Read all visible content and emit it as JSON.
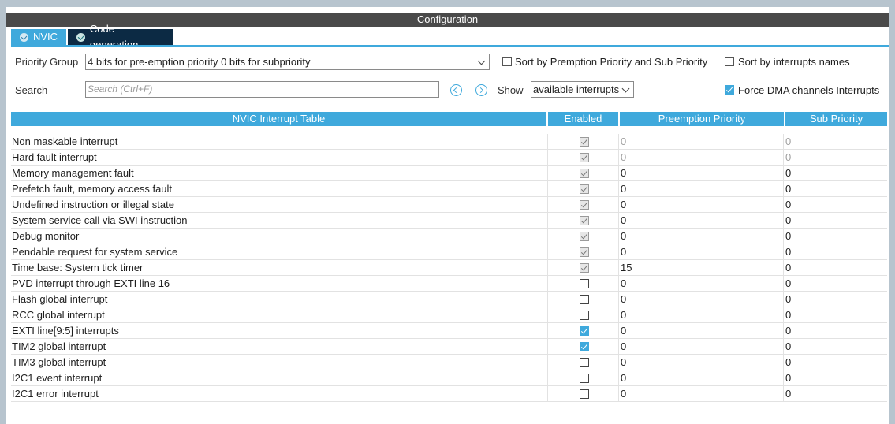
{
  "panel": {
    "title": "Configuration"
  },
  "tabs": [
    {
      "label": "NVIC",
      "active": true
    },
    {
      "label": "Code generation",
      "active": false
    }
  ],
  "priority_group": {
    "label": "Priority Group",
    "value": "4 bits for pre-emption priority 0 bits for subpriority"
  },
  "sort_options": {
    "preemption": {
      "label": "Sort by Premption Priority and Sub Priority",
      "checked": false
    },
    "names": {
      "label": "Sort by interrupts names",
      "checked": false
    }
  },
  "search": {
    "label": "Search",
    "placeholder": "Search (Ctrl+F)"
  },
  "show": {
    "label": "Show",
    "value": "available interrupts"
  },
  "force_dma": {
    "label": "Force DMA channels Interrupts",
    "checked": true
  },
  "table": {
    "headers": [
      "NVIC Interrupt Table",
      "Enabled",
      "Preemption Priority",
      "Sub Priority"
    ],
    "rows": [
      {
        "name": "Non maskable interrupt",
        "enabled": true,
        "locked": true,
        "preemption": "0",
        "sub": "0",
        "dim": true
      },
      {
        "name": "Hard fault interrupt",
        "enabled": true,
        "locked": true,
        "preemption": "0",
        "sub": "0",
        "dim": true
      },
      {
        "name": "Memory management fault",
        "enabled": true,
        "locked": true,
        "preemption": "0",
        "sub": "0",
        "dim": false
      },
      {
        "name": "Prefetch fault, memory access fault",
        "enabled": true,
        "locked": true,
        "preemption": "0",
        "sub": "0",
        "dim": false
      },
      {
        "name": "Undefined instruction or illegal state",
        "enabled": true,
        "locked": true,
        "preemption": "0",
        "sub": "0",
        "dim": false
      },
      {
        "name": "System service call via SWI instruction",
        "enabled": true,
        "locked": true,
        "preemption": "0",
        "sub": "0",
        "dim": false
      },
      {
        "name": "Debug monitor",
        "enabled": true,
        "locked": true,
        "preemption": "0",
        "sub": "0",
        "dim": false
      },
      {
        "name": "Pendable request for system service",
        "enabled": true,
        "locked": true,
        "preemption": "0",
        "sub": "0",
        "dim": false
      },
      {
        "name": "Time base: System tick timer",
        "enabled": true,
        "locked": true,
        "preemption": "15",
        "sub": "0",
        "dim": false
      },
      {
        "name": "PVD interrupt through EXTI line 16",
        "enabled": false,
        "locked": false,
        "preemption": "0",
        "sub": "0",
        "dim": false
      },
      {
        "name": "Flash global interrupt",
        "enabled": false,
        "locked": false,
        "preemption": "0",
        "sub": "0",
        "dim": false
      },
      {
        "name": "RCC global interrupt",
        "enabled": false,
        "locked": false,
        "preemption": "0",
        "sub": "0",
        "dim": false
      },
      {
        "name": "EXTI line[9:5] interrupts",
        "enabled": true,
        "locked": false,
        "preemption": "0",
        "sub": "0",
        "dim": false
      },
      {
        "name": "TIM2 global interrupt",
        "enabled": true,
        "locked": false,
        "preemption": "0",
        "sub": "0",
        "dim": false
      },
      {
        "name": "TIM3 global interrupt",
        "enabled": false,
        "locked": false,
        "preemption": "0",
        "sub": "0",
        "dim": false
      },
      {
        "name": "I2C1 event interrupt",
        "enabled": false,
        "locked": false,
        "preemption": "0",
        "sub": "0",
        "dim": false
      },
      {
        "name": "I2C1 error interrupt",
        "enabled": false,
        "locked": false,
        "preemption": "0",
        "sub": "0",
        "dim": false
      }
    ]
  },
  "colors": {
    "accent": "#3fa9dc",
    "dark_tab": "#0c2a44",
    "title_bar": "#4a4a4a"
  }
}
